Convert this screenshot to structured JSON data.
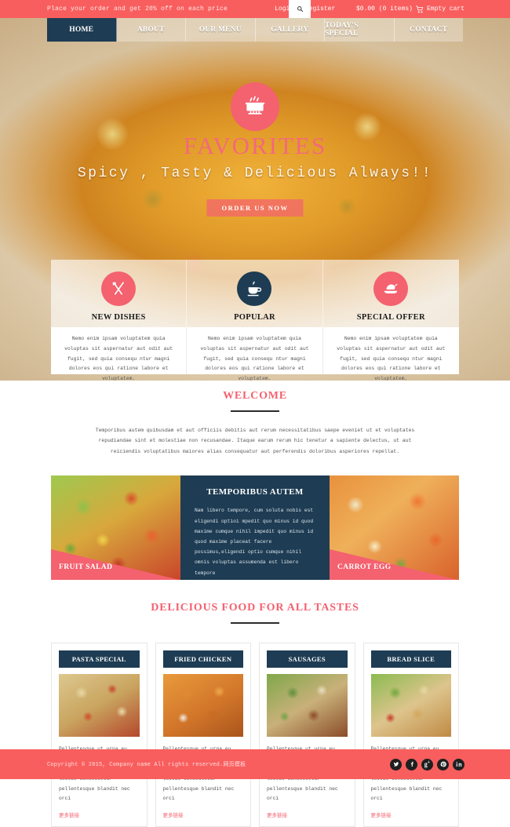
{
  "topbar": {
    "promo": "Place your order and get 20% off on each price",
    "login": "Login",
    "separator": "|",
    "register": "Register",
    "search_icon": "search-icon",
    "cart_total": "$0.00 (0 items)",
    "cart_label": "Empty cart",
    "cart_icon": "shopping-cart-icon"
  },
  "nav": {
    "items": [
      {
        "label": "HOME",
        "active": true
      },
      {
        "label": "ABOUT",
        "active": false
      },
      {
        "label": "OUR MENU",
        "active": false
      },
      {
        "label": "GALLERY",
        "active": false
      },
      {
        "label": "TODAY'S SPECIAL",
        "active": false
      },
      {
        "label": "CONTACT",
        "active": false
      }
    ]
  },
  "hero": {
    "badge_icon": "cooking-pot-icon",
    "title": "FAVORITES",
    "tagline": "Spicy , Tasty & Delicious Always!!",
    "button": "ORDER US NOW"
  },
  "features": [
    {
      "title": "NEW DISHES",
      "icon": "fork-knife-icon",
      "icon_color": "#f4616f",
      "text": "Nemo enim ipsam voluptatem quia voluptas sit aspernatur aut odit aut fugit, sed quia consequ ntur magni dolores eos qui ratione labore et voluptatem."
    },
    {
      "title": "POPULAR",
      "icon": "coffee-cup-icon",
      "icon_color": "#1e3c53",
      "text": "Nemo enim ipsam voluptatem quia voluptas sit aspernatur aut odit aut fugit, sed quia consequ ntur magni dolores eos qui ratione labore et voluptatem."
    },
    {
      "title": "SPECIAL OFFER",
      "icon": "roast-chicken-icon",
      "icon_color": "#f4616f",
      "text": "Nemo enim ipsam voluptatem quia voluptas sit aspernatur aut odit aut fugit, sed quia consequ ntur magni dolores eos qui ratione labore et voluptatem."
    }
  ],
  "welcome": {
    "title": "WELCOME",
    "text": "Temporibus autem quibusdam et aut officiis debitis aut rerum necessitatibus saepe eveniet ut et voluptates repudiandae sint et molestiae non recusandae. Itaque earum rerum hic tenetur a sapiente delectus, ut aut reiciendis voluptatibus maiores alias consequatur aut perferendis doloribus asperiores repellat."
  },
  "mid": {
    "left_label": "FRUIT SALAD",
    "right_label": "CARROT EGG",
    "panel_title": "TEMPORIBUS AUTEM",
    "panel_text": "Nam libero tempore, cum soluta nobis est eligendi optioi mpedit quo minus id quod maxime cumque nihil impedit quo minus id quod maxime placeat facere possimus,eligendi optio cumque nihil omnis voluptas assumenda est libero tempore"
  },
  "delicious": {
    "title": "DELICIOUS FOOD FOR ALL TASTES",
    "cards": [
      {
        "title": "PASTA SPECIAL",
        "text": "Pellentesque ut urna eu mauris scele risque auctor volutpat et massa pers lectus consectetur pellentesque blandit nec orci",
        "link": "更多链接"
      },
      {
        "title": "FRIED CHICKEN",
        "text": "Pellentesque ut urna eu mauris scele risque auctor volutpat et massa pers lectus consectetur pellentesque blandit nec orci",
        "link": "更多链接"
      },
      {
        "title": "SAUSAGES",
        "text": "Pellentesque ut urna eu mauris scele risque auctor volutpat et massa pers lectus consectetur pellentesque blandit nec orci",
        "link": "更多链接"
      },
      {
        "title": "BREAD SLICE",
        "text": "Pellentesque ut urna eu mauris scele risque auctor volutpat et massa pers lectus consectetur pellentesque blandit nec orci",
        "link": "更多链接"
      }
    ]
  },
  "footer": {
    "copyright": "Copyright © 2015, Company name All rights reserved.网页模板",
    "social": [
      {
        "name": "twitter-icon",
        "glyph": "t"
      },
      {
        "name": "facebook-icon",
        "glyph": "f"
      },
      {
        "name": "google-plus-icon",
        "glyph": "g"
      },
      {
        "name": "pinterest-icon",
        "glyph": "p"
      },
      {
        "name": "linkedin-icon",
        "glyph": "in"
      }
    ]
  },
  "colors": {
    "accent_red": "#f4616f",
    "bar_red": "#f95e5e",
    "navy": "#1e3c53"
  }
}
